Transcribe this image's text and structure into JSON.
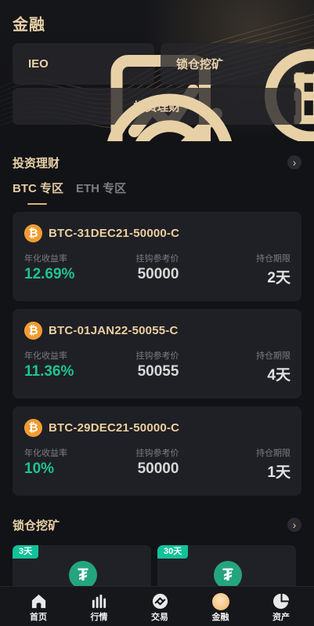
{
  "page": {
    "title": "金融"
  },
  "hero": {
    "buttons": [
      {
        "label": "IEO",
        "icon": "chart-document-icon"
      },
      {
        "label": "锁仓挖矿",
        "icon": "bitcoin-hand-icon"
      },
      {
        "label": "投资理财",
        "icon": "target-icon"
      }
    ]
  },
  "investment": {
    "title": "投资理财",
    "arrow": "›",
    "tabs": [
      {
        "label": "BTC 专区",
        "active": true
      },
      {
        "label": "ETH 专区",
        "active": false
      }
    ],
    "labels": {
      "rate": "年化收益率",
      "reference_price": "挂钩参考价",
      "term": "持仓期限"
    },
    "products": [
      {
        "name": "BTC-31DEC21-50000-C",
        "rate": "12.69%",
        "reference_price": "50000",
        "term": "2天"
      },
      {
        "name": "BTC-01JAN22-50055-C",
        "rate": "11.36%",
        "reference_price": "50055",
        "term": "4天"
      },
      {
        "name": "BTC-29DEC21-50000-C",
        "rate": "10%",
        "reference_price": "50000",
        "term": "1天"
      }
    ],
    "currency_icon": "₿"
  },
  "mining": {
    "title": "锁仓挖矿",
    "arrow": "›",
    "cards": [
      {
        "badge": "3天",
        "icon": "tether-icon",
        "symbol": "₮"
      },
      {
        "badge": "30天",
        "icon": "tether-icon",
        "symbol": "₮"
      }
    ]
  },
  "bottom_nav": {
    "items": [
      {
        "label": "首页",
        "icon": "home-icon",
        "active": false
      },
      {
        "label": "行情",
        "icon": "market-icon",
        "active": false
      },
      {
        "label": "交易",
        "icon": "trade-icon",
        "active": false
      },
      {
        "label": "金融",
        "icon": "finance-icon",
        "active": true
      },
      {
        "label": "资产",
        "icon": "asset-icon",
        "active": false
      }
    ]
  },
  "colors": {
    "background": "#121317",
    "card": "#1f2025",
    "gold": "#e8d0a6",
    "green": "#1fc48d",
    "bitcoin": "#f39b2f",
    "tether": "#24a57d"
  }
}
